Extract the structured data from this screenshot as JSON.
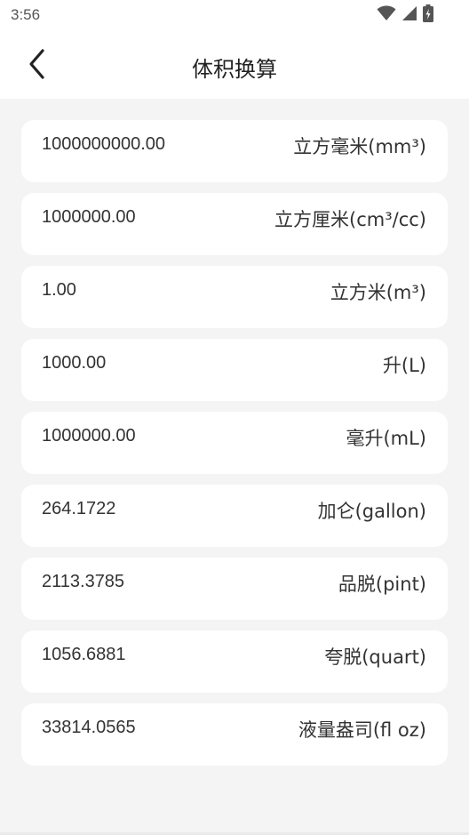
{
  "status_bar": {
    "time": "3:56",
    "icons": [
      "wifi-icon",
      "signal-icon",
      "battery-icon"
    ]
  },
  "header": {
    "title": "体积换算",
    "back_icon": "chevron-left-icon"
  },
  "conversions": [
    {
      "value": "1000000000.00",
      "unit": "立方毫米(mm³)"
    },
    {
      "value": "1000000.00",
      "unit": "立方厘米(cm³/cc)"
    },
    {
      "value": "1.00",
      "unit": "立方米(m³)"
    },
    {
      "value": "1000.00",
      "unit": "升(L)"
    },
    {
      "value": "1000000.00",
      "unit": "毫升(mL)"
    },
    {
      "value": "264.1722",
      "unit": "加仑(gallon)"
    },
    {
      "value": "2113.3785",
      "unit": "品脱(pint)"
    },
    {
      "value": "1056.6881",
      "unit": "夸脱(quart)"
    },
    {
      "value": "33814.0565",
      "unit": "液量盎司(fl oz)"
    }
  ]
}
